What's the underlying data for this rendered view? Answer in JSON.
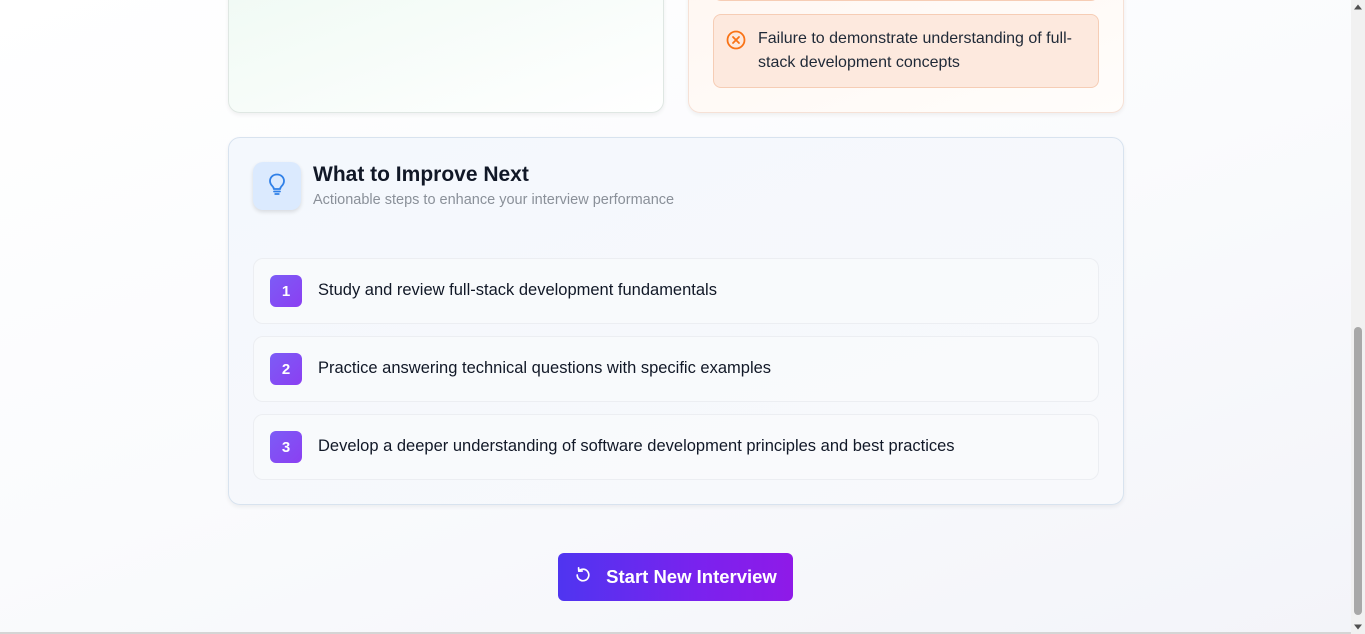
{
  "weaknesses": {
    "item_text": "Failure to demonstrate understanding of full-stack development concepts",
    "icon": "x-circle-icon",
    "accent_color": "#f97316"
  },
  "improve": {
    "title": "What to Improve Next",
    "subtitle": "Actionable steps to enhance your interview performance",
    "icon": "lightbulb-icon",
    "steps": [
      {
        "number": "1",
        "text": "Study and review full-stack development fundamentals"
      },
      {
        "number": "2",
        "text": "Practice answering technical questions with specific examples"
      },
      {
        "number": "3",
        "text": "Develop a deeper understanding of software development principles and best practices"
      }
    ]
  },
  "actions": {
    "start_label": "Start New Interview",
    "start_icon": "rotate-ccw-icon"
  }
}
